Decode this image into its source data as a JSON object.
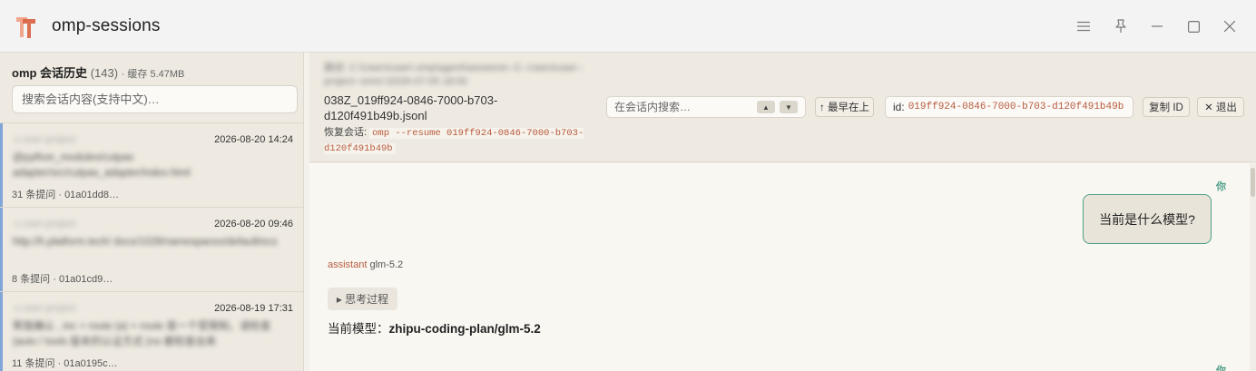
{
  "window": {
    "title": "omp-sessions",
    "controls": [
      "menu-icon",
      "pin-icon",
      "minimize-icon",
      "maximize-icon",
      "close-icon"
    ]
  },
  "sidebar": {
    "title": "omp 会话历史",
    "count": "(143)",
    "cache": "· 缓存 5.47MB",
    "search_placeholder": "搜索会话内容(支持中文)…",
    "sessions": [
      {
        "project": "c-user-project",
        "date": "2026-08-20 14:24",
        "preview": "@python_modules/cutpas adapter/src/cutpas_adapter/index.html",
        "meta": "31 条提问 · 01a01dd8…",
        "accent": "#7fa6d6"
      },
      {
        "project": "c-user-project",
        "date": "2026-08-20 09:46",
        "preview": "http://h.platform.tech/ docs/1028/namespaces/default/ecs",
        "meta": "8 条提问 · 01a01cd9…",
        "accent": "#7fa6d6"
      },
      {
        "project": "c-user-project",
        "date": "2026-08-19 17:31",
        "preview": "帮我确认 , inc + route (a) + route 是一个受限制，请检查 (auto / tools 版本的认证方式 (no 都检查出来",
        "meta": "11 条提问 · 01a0195c…",
        "accent": "#7fa6d6"
      }
    ]
  },
  "header": {
    "path_blurred": "路径: C:\\Users\\user\\.omp\\agent\\sessions\\--C--Users\\user--project--omni-\\2026-07-05 18:00",
    "path_file": "038Z_019ff924-0846-7000-b703-d120f491b49b.jsonl",
    "resume_label": "恢复会话:",
    "resume_cmd": "omp --resume 019ff924-0846-7000-b703-d120f491b49b",
    "inconv_search_placeholder": "在会话内搜索…",
    "up_arrow": "▲",
    "down_arrow": "▼",
    "oldest_first": "↑ 最早在上",
    "id_label": "id:",
    "id_value": "019ff924-0846-7000-b703-d120f491b49b",
    "copy_id": "复制 ID",
    "exit": "✕ 退出"
  },
  "conversation": {
    "you_label": "你",
    "user_message": "当前是什么模型?",
    "assistant_role": "assistant",
    "assistant_model": "glm-5.2",
    "thinking_toggle": "▸ 思考过程",
    "answer_prefix": "当前模型：",
    "answer_value": "zhipu-coding-plan/glm-5.2"
  }
}
